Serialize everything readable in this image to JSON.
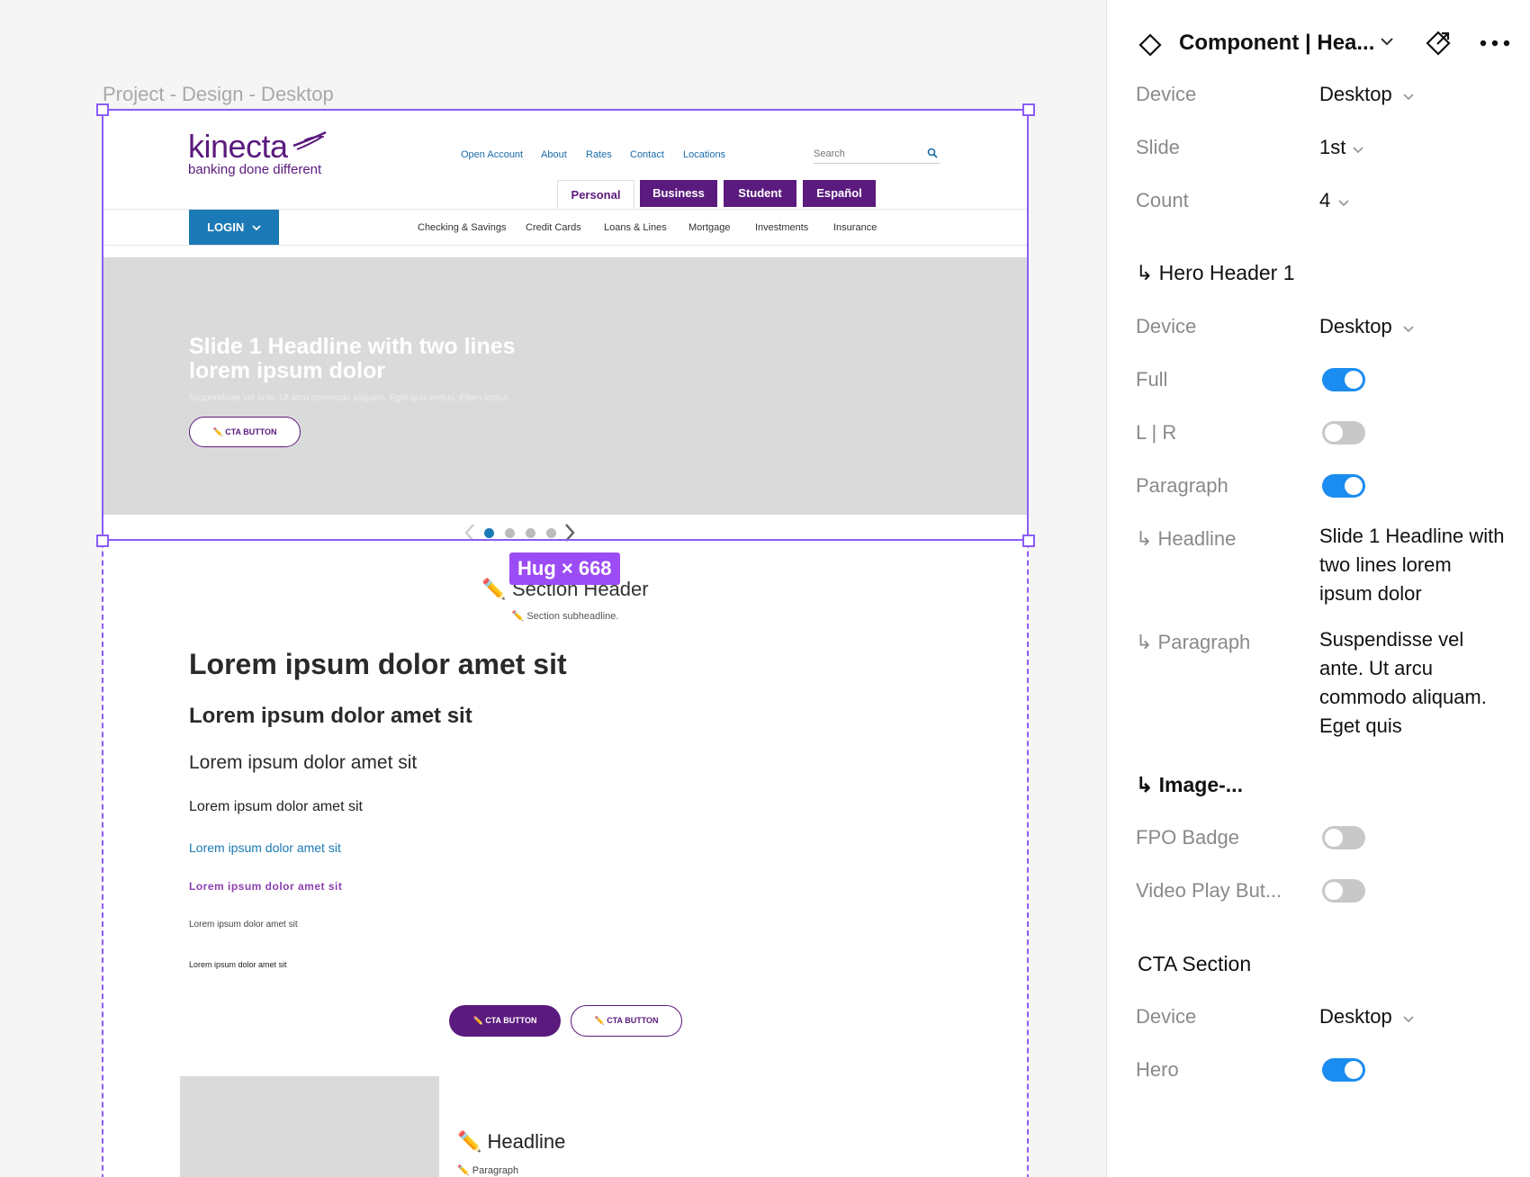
{
  "canvas": {
    "frame_label": "Project - Design - Desktop",
    "hug_badge": "Hug × 668"
  },
  "site": {
    "logo": {
      "word": "kinecta",
      "tagline": "banking done different"
    },
    "utility_nav": [
      "Open Account",
      "About",
      "Rates",
      "Contact",
      "Locations"
    ],
    "search_placeholder": "Search",
    "segments": [
      "Personal",
      "Business",
      "Student",
      "Español"
    ],
    "login_label": "LOGIN",
    "main_nav": [
      "Checking & Savings",
      "Credit Cards",
      "Loans & Lines",
      "Mortgage",
      "Investments",
      "Insurance"
    ],
    "hero": {
      "headline": "Slide 1 Headline with two lines lorem ipsum dolor",
      "paragraph": "Suspendisse vel ante. Ut arcu commodo aliquam. Eget quis metus. Etiam lectus.",
      "cta": "CTA BUTTON"
    },
    "carousel": {
      "total": 4,
      "active": 1
    },
    "section": {
      "header": "Section Header",
      "subheadline": "Section subheadline."
    },
    "type_samples": [
      "Lorem ipsum dolor amet sit",
      "Lorem ipsum dolor amet sit",
      "Lorem ipsum dolor amet sit",
      "Lorem ipsum dolor amet sit",
      "Lorem ipsum dolor amet sit",
      "Lorem ipsum dolor amet sit",
      "Lorem ipsum dolor amet sit",
      "Lorem ipsum dolor amet sit"
    ],
    "cta_buttons": [
      "CTA BUTTON",
      "CTA BUTTON"
    ],
    "card": {
      "headline": "Headline",
      "paragraph": "Paragraph"
    },
    "pencil": "✏️"
  },
  "panel": {
    "title": "Component | Hea...",
    "props": {
      "device_label": "Device",
      "device_value": "Desktop",
      "slide_label": "Slide",
      "slide_value": "1st",
      "count_label": "Count",
      "count_value": "4"
    },
    "hero_header": {
      "title": "↳ Hero Header 1",
      "device_label": "Device",
      "device_value": "Desktop",
      "full_label": "Full",
      "full_on": true,
      "lr_label": "L | R",
      "lr_on": false,
      "paragraph_label": "Paragraph",
      "paragraph_on": true,
      "headline_label": "↳ Headline",
      "headline_value": "Slide 1 Headline with two lines lorem ipsum dolor",
      "paragraph_text_label": "↳ Paragraph",
      "paragraph_value": "Suspendisse vel ante. Ut arcu commodo aliquam. Eget quis"
    },
    "image_section": {
      "title": "↳ Image-...",
      "fpo_label": "FPO Badge",
      "fpo_on": false,
      "video_label": "Video Play But...",
      "video_on": false
    },
    "cta_section": {
      "title": "CTA Section",
      "device_label": "Device",
      "device_value": "Desktop",
      "hero_label": "Hero",
      "hero_on": true
    }
  }
}
